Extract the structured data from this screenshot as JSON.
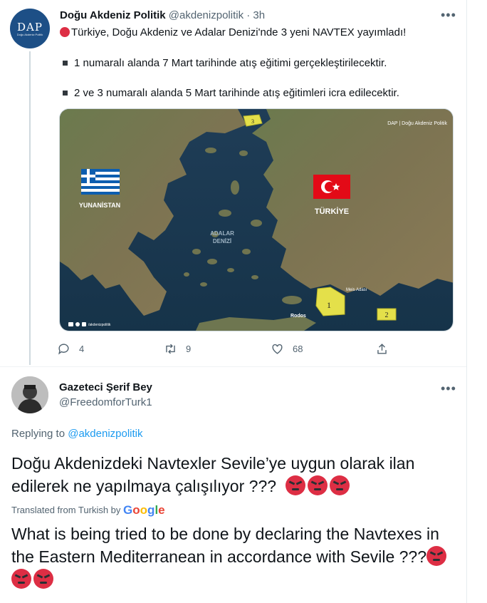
{
  "tweet": {
    "author_name": "Doğu Akdeniz Politik",
    "author_handle": "@akdenizpolitik",
    "time": "· 3h",
    "avatar_text": "DAP",
    "avatar_subtext": "Doğu Akdeniz Politik",
    "line1": "Türkiye, Doğu Akdeniz ve Adalar Denizi'nde 3 yeni NAVTEX yayımladı!",
    "bullet1": "1 numaralı alanda 7 Mart tarihinde atış eğitimi gerçekleştirilecektir.",
    "bullet2": "2 ve 3 numaralı alanda 5 Mart tarihinde atış eğitimleri icra edilecektir.",
    "map": {
      "label_greece": "YUNANİSTAN",
      "label_turkey": "TÜRKİYE",
      "label_sea_1": "ADALAR",
      "label_sea_2": "DENİZİ",
      "label_rodos": "Rodos",
      "label_meis": "Meis Adası",
      "area_1": "1",
      "area_2": "2",
      "area_3": "3",
      "watermark": "DAP | Doğu Akdeniz Politik",
      "footer": "/akdenizpolitik"
    },
    "actions": {
      "replies": "4",
      "retweets": "9",
      "likes": "68"
    }
  },
  "reply": {
    "author_name": "Gazeteci Şerif Bey",
    "author_handle": "@FreedomforTurk1",
    "replying_prefix": "Replying to",
    "replying_to": "@akdenizpolitik",
    "text_original": "Doğu Akdenizdeki Navtexler Sevile’ye uygun olarak ilan edilerek ne yapılmaya çalışılıyor ???",
    "translated_from": "Translated from Turkish by",
    "translator": "Google",
    "text_translated": "What is being tried to be done by declaring the Navtexes in the Eastern Mediterranean in accordance with Sevile ???"
  },
  "colors": {
    "link": "#1d9bf0",
    "muted": "#536471",
    "avatar_bg": "#1d4f86",
    "navtex_area": "#e4e04a"
  },
  "icons": [
    "red-circle-icon",
    "bullet-square-icon",
    "greece-flag-icon",
    "turkey-flag-icon",
    "reply-icon",
    "retweet-icon",
    "like-icon",
    "share-icon",
    "more-icon",
    "angry-face-icon"
  ]
}
